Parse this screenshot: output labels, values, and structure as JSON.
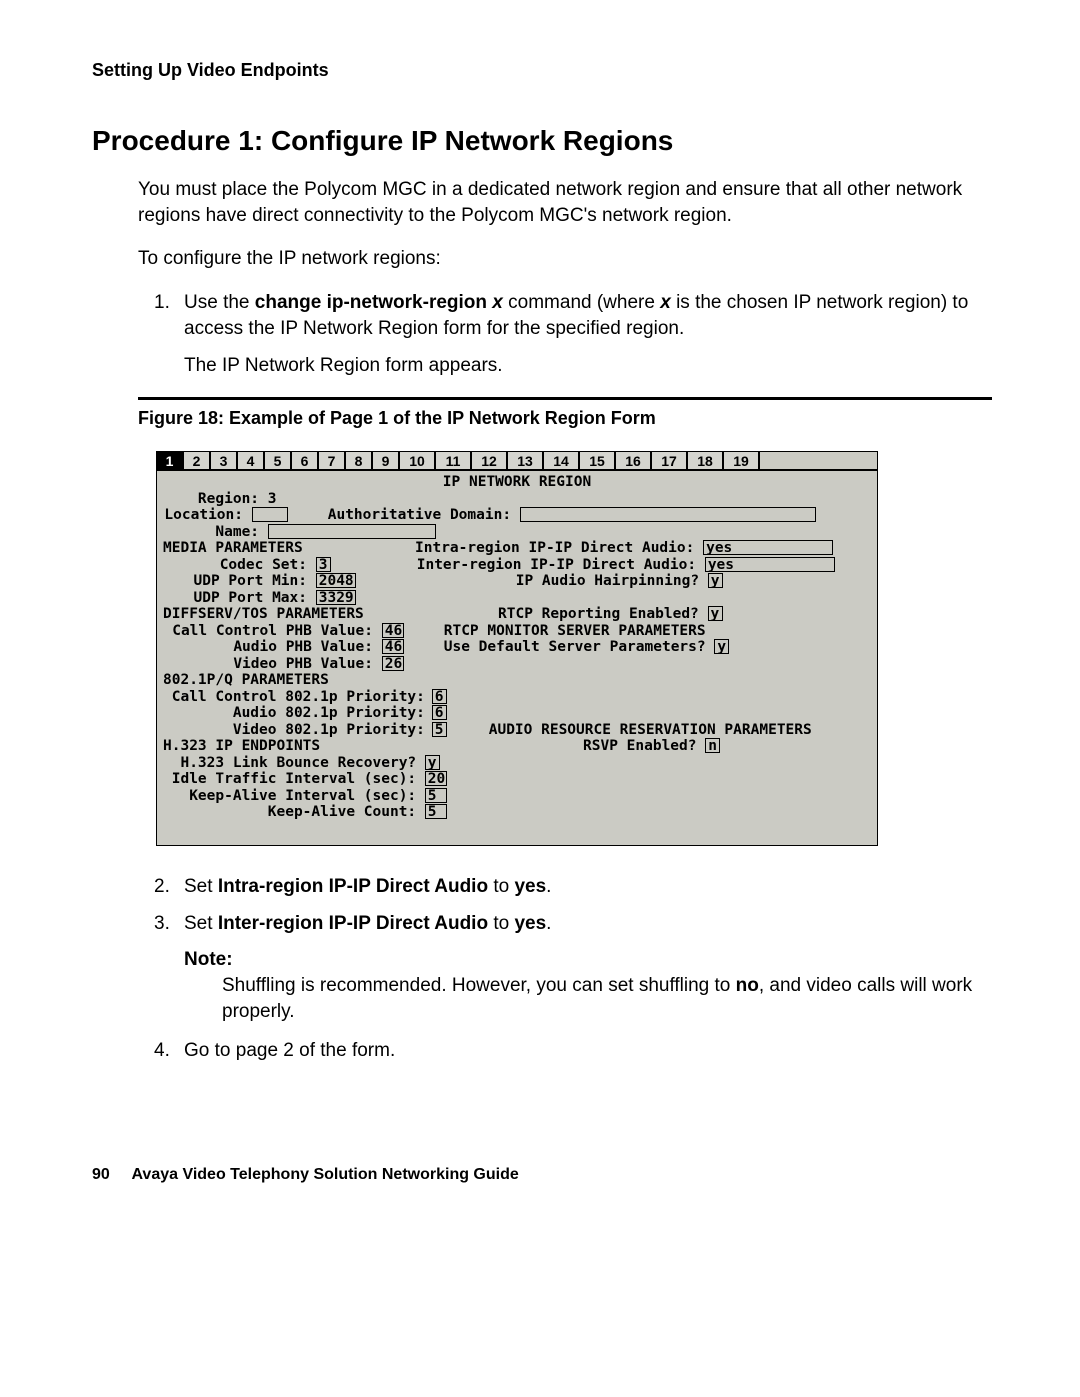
{
  "section_header": "Setting Up Video Endpoints",
  "heading": "Procedure 1: Configure IP Network Regions",
  "intro": "You must place the Polycom MGC in a dedicated network region and ensure that all other network regions have direct connectivity to the Polycom MGC's network region.",
  "lead_in": "To configure the IP network regions:",
  "step1": {
    "num": "1.",
    "t1": "Use the ",
    "bold": "change ip-network-region ",
    "italic1": "x",
    "t2": " command (where ",
    "italic2": "x",
    "t3": " is the chosen IP network region) to access the IP Network Region form for the specified region.",
    "sub": "The IP Network Region form appears."
  },
  "figure_caption": "Figure 18: Example of Page 1 of the IP Network Region Form",
  "terminal": {
    "tabs": [
      "1",
      "2",
      "3",
      "4",
      "5",
      "6",
      "7",
      "8",
      "9",
      "10",
      "11",
      "12",
      "13",
      "14",
      "15",
      "16",
      "17",
      "18",
      "19"
    ],
    "title": "IP NETWORK REGION",
    "region_lbl": "    Region:",
    "region_val": "3",
    "location_lbl": "Location:",
    "location_val": "",
    "auth_lbl": "Authoritative Domain:",
    "auth_val": "",
    "name_lbl": "      Name:",
    "name_val": "",
    "media_hdr": "MEDIA PARAMETERS",
    "intra_lbl": "Intra-region IP-IP Direct Audio:",
    "intra_val": "yes",
    "codec_lbl": "      Codec Set:",
    "codec_val": "3",
    "inter_lbl": "Inter-region IP-IP Direct Audio:",
    "inter_val": "yes",
    "udpmin_lbl": "   UDP Port Min:",
    "udpmin_val": "2048",
    "hairpin_lbl": "IP Audio Hairpinning?",
    "hairpin_val": "y",
    "udpmax_lbl": "   UDP Port Max:",
    "udpmax_val": "3329",
    "diff_hdr": "DIFFSERV/TOS PARAMETERS",
    "rtcp_lbl": "RTCP Reporting Enabled?",
    "rtcp_val": "y",
    "cc_phb_lbl": " Call Control PHB Value:",
    "cc_phb_val": "46",
    "rtcp_mon_hdr": "RTCP MONITOR SERVER PARAMETERS",
    "audio_phb_lbl": "        Audio PHB Value:",
    "audio_phb_val": "46",
    "use_def_lbl": "Use Default Server Parameters?",
    "use_def_val": "y",
    "video_phb_lbl": "        Video PHB Value:",
    "video_phb_val": "26",
    "dot1p_hdr": "802.1P/Q PARAMETERS",
    "cc_1p_lbl": " Call Control 802.1p Priority:",
    "cc_1p_val": "6",
    "audio_1p_lbl": "        Audio 802.1p Priority:",
    "audio_1p_val": "6",
    "video_1p_lbl": "        Video 802.1p Priority:",
    "video_1p_val": "5",
    "arr_hdr": "AUDIO RESOURCE RESERVATION PARAMETERS",
    "h323_hdr": "H.323 IP ENDPOINTS",
    "rsvp_lbl": "RSVP Enabled?",
    "rsvp_val": "n",
    "link_lbl": "  H.323 Link Bounce Recovery?",
    "link_val": "y",
    "idle_lbl": " Idle Traffic Interval (sec):",
    "idle_val": "20",
    "keep_int_lbl": "   Keep-Alive Interval (sec):",
    "keep_int_val": "5",
    "keep_cnt_lbl": "            Keep-Alive Count:",
    "keep_cnt_val": "5"
  },
  "step2": {
    "num": "2.",
    "t1": "Set ",
    "b": "Intra-region IP-IP Direct Audio",
    "t2": " to ",
    "b2": "yes",
    "t3": "."
  },
  "step3": {
    "num": "3.",
    "t1": "Set ",
    "b": "Inter-region IP-IP Direct Audio",
    "t2": " to ",
    "b2": "yes",
    "t3": "."
  },
  "note_label": "Note:",
  "note": {
    "t1": "Shuffling is recommended. However, you can set shuffling to ",
    "b": "no",
    "t2": ", and video calls will work properly."
  },
  "step4": {
    "num": "4.",
    "t": "Go to page 2 of the form."
  },
  "footer": {
    "page": "90",
    "title": "Avaya Video Telephony Solution Networking Guide"
  }
}
